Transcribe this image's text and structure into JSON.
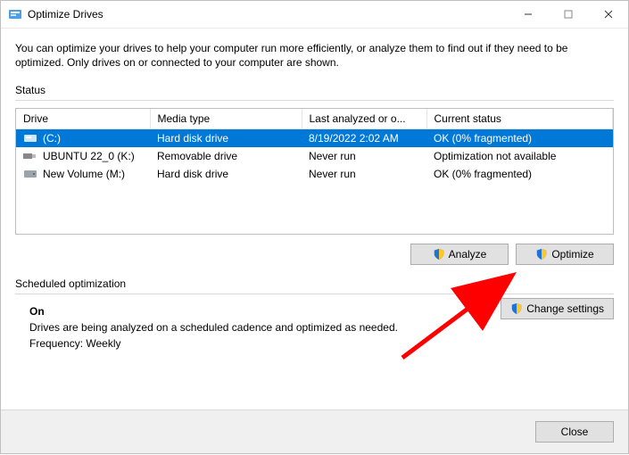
{
  "window": {
    "title": "Optimize Drives"
  },
  "intro": "You can optimize your drives to help your computer run more efficiently, or analyze them to find out if they need to be optimized. Only drives on or connected to your computer are shown.",
  "status_label": "Status",
  "columns": {
    "c0": "Drive",
    "c1": "Media type",
    "c2": "Last analyzed or o...",
    "c3": "Current status"
  },
  "drives": [
    {
      "name": "(C:)",
      "icon": "hdd",
      "media": "Hard disk drive",
      "last": "8/19/2022 2:02 AM",
      "status": "OK (0% fragmented)",
      "selected": true
    },
    {
      "name": "UBUNTU 22_0 (K:)",
      "icon": "usb",
      "media": "Removable drive",
      "last": "Never run",
      "status": "Optimization not available",
      "selected": false
    },
    {
      "name": "New Volume (M:)",
      "icon": "hdd2",
      "media": "Hard disk drive",
      "last": "Never run",
      "status": "OK (0% fragmented)",
      "selected": false
    }
  ],
  "buttons": {
    "analyze": "Analyze",
    "optimize": "Optimize",
    "change": "Change settings",
    "close": "Close"
  },
  "schedule": {
    "label": "Scheduled optimization",
    "state": "On",
    "desc": "Drives are being analyzed on a scheduled cadence and optimized as needed.",
    "freq": "Frequency: Weekly"
  }
}
